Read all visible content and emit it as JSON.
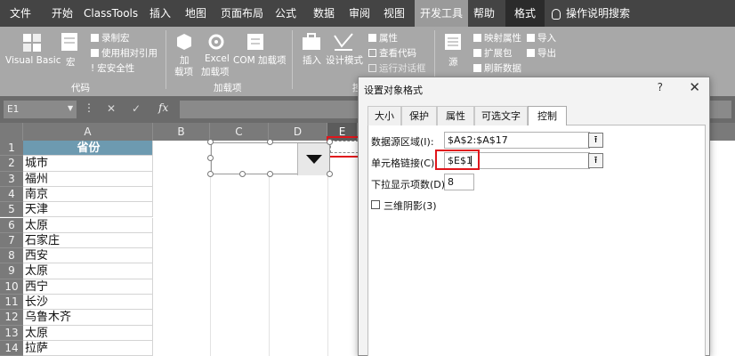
{
  "ribbon_tabs": [
    {
      "label": "文件"
    },
    {
      "label": "开始"
    },
    {
      "label": "ClassTools"
    },
    {
      "label": "插入"
    },
    {
      "label": "地图"
    },
    {
      "label": "页面布局"
    },
    {
      "label": "公式"
    },
    {
      "label": "数据"
    },
    {
      "label": "审阅"
    },
    {
      "label": "视图"
    },
    {
      "label": "开发工具"
    },
    {
      "label": "帮助"
    },
    {
      "label": "格式"
    }
  ],
  "tell_me": "操作说明搜索",
  "ribbon": {
    "code_group": {
      "visual_basic": "Visual Basic",
      "macros": "宏",
      "record_macro": "录制宏",
      "relative_refs": "使用相对引用",
      "macro_security": "宏安全性",
      "label": "代码"
    },
    "addins_group": {
      "addins_line1": "加",
      "addins_line2": "载项",
      "excel_addins_line1": "Excel",
      "excel_addins_line2": "加载项",
      "com_addins": "COM 加载项",
      "label": "加载项"
    },
    "controls_group": {
      "insert": "插入",
      "design_mode": "设计模式",
      "properties": "属性",
      "view_code": "查看代码",
      "run_dialog": "运行对话框",
      "label": "控"
    },
    "xml_group": {
      "source": "源",
      "map_properties": "映射属性",
      "expansion_packs": "扩展包",
      "refresh_data": "刷新数据",
      "import": "导入",
      "export": "导出"
    }
  },
  "formula_bar": {
    "name_box": "E1",
    "cancel": "✕",
    "enter": "✓",
    "fx": "fx"
  },
  "columns": [
    "A",
    "B",
    "C",
    "D",
    "E"
  ],
  "rows": [
    "1",
    "2",
    "3",
    "4",
    "5",
    "6",
    "7",
    "8",
    "9",
    "10",
    "11",
    "12",
    "13",
    "14"
  ],
  "column_a": [
    "省份",
    "城市",
    "福州",
    "南京",
    "天津",
    "太原",
    "石家庄",
    "西安",
    "太原",
    "西宁",
    "长沙",
    "乌鲁木齐",
    "太原",
    "拉萨"
  ],
  "dialog": {
    "title": "设置对象格式",
    "help": "?",
    "close": "✕",
    "tabs": [
      "大小",
      "保护",
      "属性",
      "可选文字",
      "控制"
    ],
    "input_range_label": "数据源区域(I):",
    "input_range_value": "$A$2:$A$17",
    "cell_link_label": "单元格链接(C):",
    "cell_link_value": "$E$1",
    "dropdown_lines_label": "下拉显示项数(D):",
    "dropdown_lines_value": "8",
    "shading_label": "三维阴影(3)"
  },
  "colors": {
    "tab_bar": "#444444",
    "ribbon": "#a8a8a8",
    "header_fill": "#6d9ab0",
    "highlight": "#e0161c"
  }
}
